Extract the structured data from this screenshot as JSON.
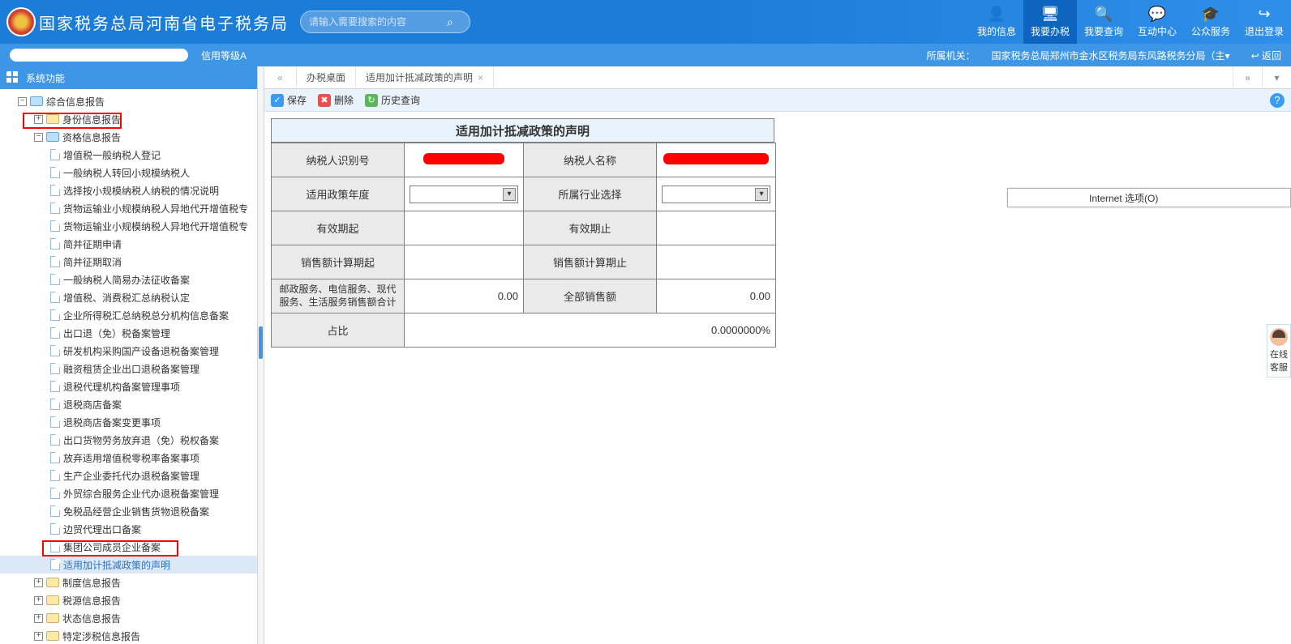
{
  "header": {
    "site_title": "国家税务总局河南省电子税务局",
    "search_placeholder": "请输入需要搜索的内容",
    "nav": [
      {
        "label": "我的信息",
        "icon": "👤"
      },
      {
        "label": "我要办税",
        "icon": "🖥"
      },
      {
        "label": "我要查询",
        "icon": "🔍"
      },
      {
        "label": "互动中心",
        "icon": "💬"
      },
      {
        "label": "公众服务",
        "icon": "🎓"
      },
      {
        "label": "退出登录",
        "icon": "↪"
      }
    ]
  },
  "subheader": {
    "credit": "信用等级A",
    "org_label": "所属机关：",
    "org_value": "国家税务总局郑州市金水区税务局东风路税务分局（主▾",
    "back": "返回"
  },
  "sidebar": {
    "title": "系统功能",
    "tree": {
      "root": "综合信息报告",
      "sub1": "身份信息报告",
      "sub2": "资格信息报告",
      "leaves": [
        "增值税一般纳税人登记",
        "一般纳税人转回小规模纳税人",
        "选择按小规模纳税人纳税的情况说明",
        "货物运输业小规模纳税人异地代开增值税专",
        "货物运输业小规模纳税人异地代开增值税专",
        "简并征期申请",
        "简并征期取消",
        "一般纳税人简易办法征收备案",
        "增值税、消费税汇总纳税认定",
        "企业所得税汇总纳税总分机构信息备案",
        "出口退（免）税备案管理",
        "研发机构采购国产设备退税备案管理",
        "融资租赁企业出口退税备案管理",
        "退税代理机构备案管理事项",
        "退税商店备案",
        "退税商店备案变更事项",
        "出口货物劳务放弃退（免）税权备案",
        "放弃适用增值税零税率备案事项",
        "生产企业委托代办退税备案管理",
        "外贸综合服务企业代办退税备案管理",
        "免税品经营企业销售货物退税备案",
        "边贸代理出口备案",
        "集团公司成员企业备案",
        "适用加计抵减政策的声明"
      ],
      "after": [
        "制度信息报告",
        "税源信息报告",
        "状态信息报告",
        "特定涉税信息报告"
      ]
    }
  },
  "tabs": {
    "t1": "办税桌面",
    "t2": "适用加计抵减政策的声明"
  },
  "toolbar": {
    "save": "保存",
    "del": "删除",
    "hist": "历史查询"
  },
  "form": {
    "title": "适用加计抵减政策的声明",
    "taxpayer_id_label": "纳税人识别号",
    "taxpayer_name_label": "纳税人名称",
    "policy_year_label": "适用政策年度",
    "industry_label": "所属行业选择",
    "valid_from_label": "有效期起",
    "valid_to_label": "有效期止",
    "sales_calc_from_label": "销售额计算期起",
    "sales_calc_to_label": "销售额计算期止",
    "postal_label": "邮政服务、电信服务、现代服务、生活服务销售额合计",
    "postal_value": "0.00",
    "total_sales_label": "全部销售额",
    "total_sales_value": "0.00",
    "ratio_label": "占比",
    "ratio_value": "0.0000000%"
  },
  "internet_popup": "Internet 选项(O)",
  "float_help": "在线客服"
}
